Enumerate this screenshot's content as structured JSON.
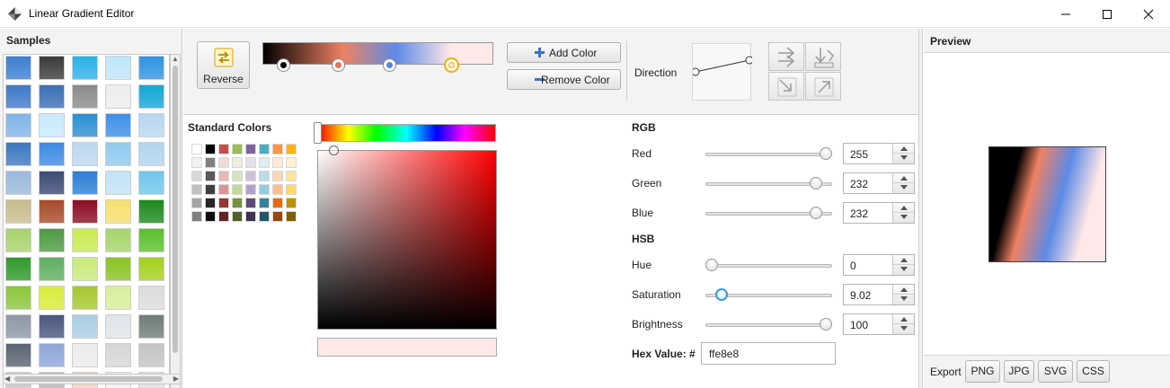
{
  "window": {
    "title": "Linear Gradient Editor",
    "icon": "gradient-app-icon",
    "controls": [
      "minimize-icon",
      "maximize-icon",
      "close-icon"
    ]
  },
  "samples": {
    "title": "Samples",
    "swatches": [
      [
        "#3d7fcf",
        "#3a3a3a",
        "#2bb2e6",
        "#bfe6fb",
        "#2f93e0"
      ],
      [
        "#3f79c8",
        "#3a6fb6",
        "#8b8b8b",
        "#ededed",
        "#12a8d6"
      ],
      [
        "#7fb5e8",
        "#c8ebfb",
        "#2a8fd2",
        "#3d8fe8",
        "#b9d6f0"
      ],
      [
        "#3b78c0",
        "#3b8be3",
        "#bdd8f0",
        "#8ecbee",
        "#b2d4ee"
      ],
      [
        "#9ab9dc",
        "#3c4a74",
        "#2b7fd6",
        "#c2e3f7",
        "#6fc6ec"
      ],
      [
        "#c8bb8e",
        "#a64b2a",
        "#8b0e23",
        "#f6df6e",
        "#1c8a1c"
      ],
      [
        "#a8d36b",
        "#4e9a43",
        "#c8ea52",
        "#a6d46a",
        "#5bbf2b"
      ],
      [
        "#2f9a2b",
        "#5faf5f",
        "#c8ea7a",
        "#8ac321",
        "#a3d11c"
      ],
      [
        "#8cc63b",
        "#d8ec3a",
        "#a4c830",
        "#d7ee9a",
        "#dcdcdc"
      ],
      [
        "#8e98a6",
        "#4a5680",
        "#a9cde3",
        "#dfe5ea",
        "#6e7d7a"
      ],
      [
        "#5a6470",
        "#8ea6d6",
        "#ececec",
        "#d6d6d6",
        "#c4c4c4"
      ],
      [
        "#c8c8c8",
        "#b8b8b8",
        "#e8d6c8",
        "#f0f0f0",
        "#e0e0e0"
      ]
    ]
  },
  "toolbar": {
    "reverse_label": "Reverse",
    "reverse_icon": "reverse-arrow-icon",
    "add_color_label": "Add Color",
    "add_icon": "plus-icon",
    "remove_color_label": "Remove Color",
    "remove_icon": "minus-icon",
    "direction_label": "Direction",
    "gradient_stops": [
      {
        "color": "#000000",
        "position": 0.09
      },
      {
        "color": "#e8735a",
        "position": 0.33
      },
      {
        "color": "#5585e0",
        "position": 0.55
      },
      {
        "color": "#ffe8e8",
        "position": 0.82,
        "selected": true
      }
    ],
    "direction_buttons": [
      "direction-left-to-right-icon",
      "direction-top-to-bottom-icon",
      "direction-bottom-left-icon",
      "direction-bottom-right-icon"
    ]
  },
  "picker": {
    "standard_colors_title": "Standard Colors",
    "standard_colors": [
      [
        "#ffffff",
        "#000000",
        "#c0504d",
        "#9bbb59",
        "#8064a2",
        "#4bacc6",
        "#f79646",
        "#ffb400"
      ],
      [
        "#f2f2f2",
        "#7f7f7f",
        "#f2dcdb",
        "#ebf1de",
        "#e6e0ec",
        "#dbeef3",
        "#fde9d9",
        "#fff2cc"
      ],
      [
        "#d8d8d8",
        "#595959",
        "#e6b9b8",
        "#d7e4bd",
        "#ccc1d9",
        "#b7dde8",
        "#fbd5b5",
        "#ffe599"
      ],
      [
        "#bfbfbf",
        "#3f3f3f",
        "#d99694",
        "#c3d69b",
        "#b3a2c7",
        "#92cddc",
        "#fac08f",
        "#ffd966"
      ],
      [
        "#a5a5a5",
        "#262626",
        "#953734",
        "#76923c",
        "#5f497a",
        "#31859b",
        "#e36c09",
        "#bf9000"
      ],
      [
        "#7f7f7f",
        "#0c0c0c",
        "#632423",
        "#4f6128",
        "#3f3151",
        "#205867",
        "#974806",
        "#7f6000"
      ]
    ],
    "current_color": "#ffe8e8"
  },
  "rgb": {
    "title": "RGB",
    "red": {
      "label": "Red",
      "value": "255",
      "fraction": 1.0
    },
    "green": {
      "label": "Green",
      "value": "232",
      "fraction": 0.91
    },
    "blue": {
      "label": "Blue",
      "value": "232",
      "fraction": 0.91
    }
  },
  "hsb": {
    "title": "HSB",
    "hue": {
      "label": "Hue",
      "value": "0",
      "fraction": 0.0
    },
    "saturation": {
      "label": "Saturation",
      "value": "9.02",
      "fraction": 0.09
    },
    "brightness": {
      "label": "Brightness",
      "value": "100",
      "fraction": 1.0
    }
  },
  "hex": {
    "label": "Hex Value: #",
    "value": "ffe8e8"
  },
  "preview": {
    "title": "Preview",
    "export_label": "Export",
    "export_buttons": [
      "PNG",
      "JPG",
      "SVG",
      "CSS"
    ]
  }
}
